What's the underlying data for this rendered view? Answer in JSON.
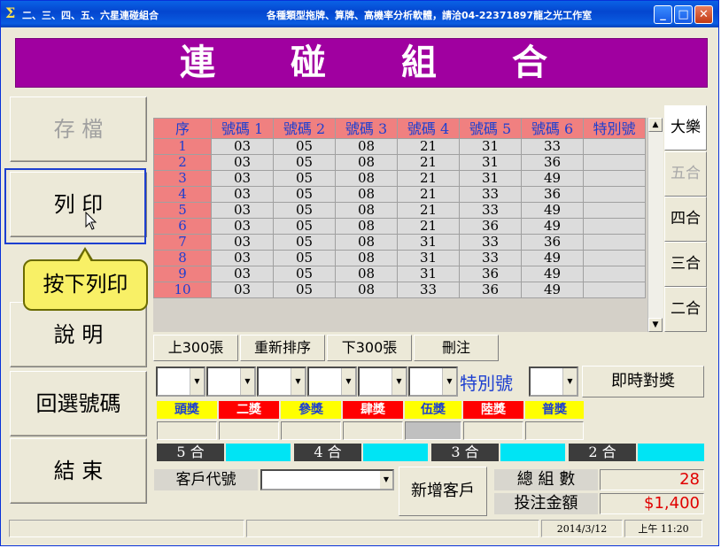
{
  "window": {
    "title": "二、三、四、五、六星連碰組合",
    "subtitle": "各種類型拖牌、算牌、高機率分析軟體，請洽04-22371897龍之光工作室"
  },
  "banner": {
    "chars": [
      "連",
      "碰",
      "組",
      "合"
    ]
  },
  "left_buttons": [
    {
      "label": "存 檔",
      "enabled": false
    },
    {
      "label": "列 印",
      "enabled": true
    },
    {
      "label": "說 明",
      "enabled": true
    },
    {
      "label": "回選號碼",
      "enabled": true
    },
    {
      "label": "結 束",
      "enabled": true
    }
  ],
  "tooltip": "按下列印",
  "grid": {
    "headers": [
      "序",
      "號碼 1",
      "號碼 2",
      "號碼 3",
      "號碼 4",
      "號碼 5",
      "號碼 6",
      "特別號"
    ],
    "rows": [
      [
        "1",
        "03",
        "05",
        "08",
        "21",
        "31",
        "33",
        ""
      ],
      [
        "2",
        "03",
        "05",
        "08",
        "21",
        "31",
        "36",
        ""
      ],
      [
        "3",
        "03",
        "05",
        "08",
        "21",
        "31",
        "49",
        ""
      ],
      [
        "4",
        "03",
        "05",
        "08",
        "21",
        "33",
        "36",
        ""
      ],
      [
        "5",
        "03",
        "05",
        "08",
        "21",
        "33",
        "49",
        ""
      ],
      [
        "6",
        "03",
        "05",
        "08",
        "21",
        "36",
        "49",
        ""
      ],
      [
        "7",
        "03",
        "05",
        "08",
        "31",
        "33",
        "36",
        ""
      ],
      [
        "8",
        "03",
        "05",
        "08",
        "31",
        "33",
        "49",
        ""
      ],
      [
        "9",
        "03",
        "05",
        "08",
        "31",
        "36",
        "49",
        ""
      ],
      [
        "10",
        "03",
        "05",
        "08",
        "33",
        "36",
        "49",
        ""
      ]
    ]
  },
  "right_buttons": [
    {
      "label": "大樂",
      "state": "active"
    },
    {
      "label": "五合",
      "state": "disabled"
    },
    {
      "label": "四合",
      "state": "normal"
    },
    {
      "label": "三合",
      "state": "normal"
    },
    {
      "label": "二合",
      "state": "normal"
    }
  ],
  "actions": {
    "prev": "上300張",
    "resort": "重新排序",
    "next": "下300張",
    "delete": "刪注"
  },
  "special_label": "特別號",
  "instant_button": "即時對獎",
  "prizes": [
    {
      "label": "頭獎",
      "bg": "#ffff00",
      "fg": "#1d3fd0"
    },
    {
      "label": "二獎",
      "bg": "#ff0000",
      "fg": "#ffffff"
    },
    {
      "label": "參獎",
      "bg": "#ffff00",
      "fg": "#1d3fd0"
    },
    {
      "label": "肆獎",
      "bg": "#ff0000",
      "fg": "#ffffff"
    },
    {
      "label": "伍獎",
      "bg": "#ffff00",
      "fg": "#1d3fd0"
    },
    {
      "label": "陸獎",
      "bg": "#ff0000",
      "fg": "#ffffff"
    },
    {
      "label": "普獎",
      "bg": "#ffff00",
      "fg": "#1d3fd0"
    }
  ],
  "hits": [
    "5 合",
    "4 合",
    "3 合",
    "2 合"
  ],
  "customer": {
    "label": "客戶代號",
    "add_button": "新增客戶"
  },
  "summary": {
    "total_label": "總 組 數",
    "total_value": "28",
    "amount_label": "投注金額",
    "amount_value": "$1,400"
  },
  "status": {
    "date": "2014/3/12",
    "time": "上午 11:20"
  },
  "colors": {
    "banner": "#a000a0",
    "header": "#f08080",
    "accent": "#1d3fd0",
    "hit": "#00e4f4"
  }
}
